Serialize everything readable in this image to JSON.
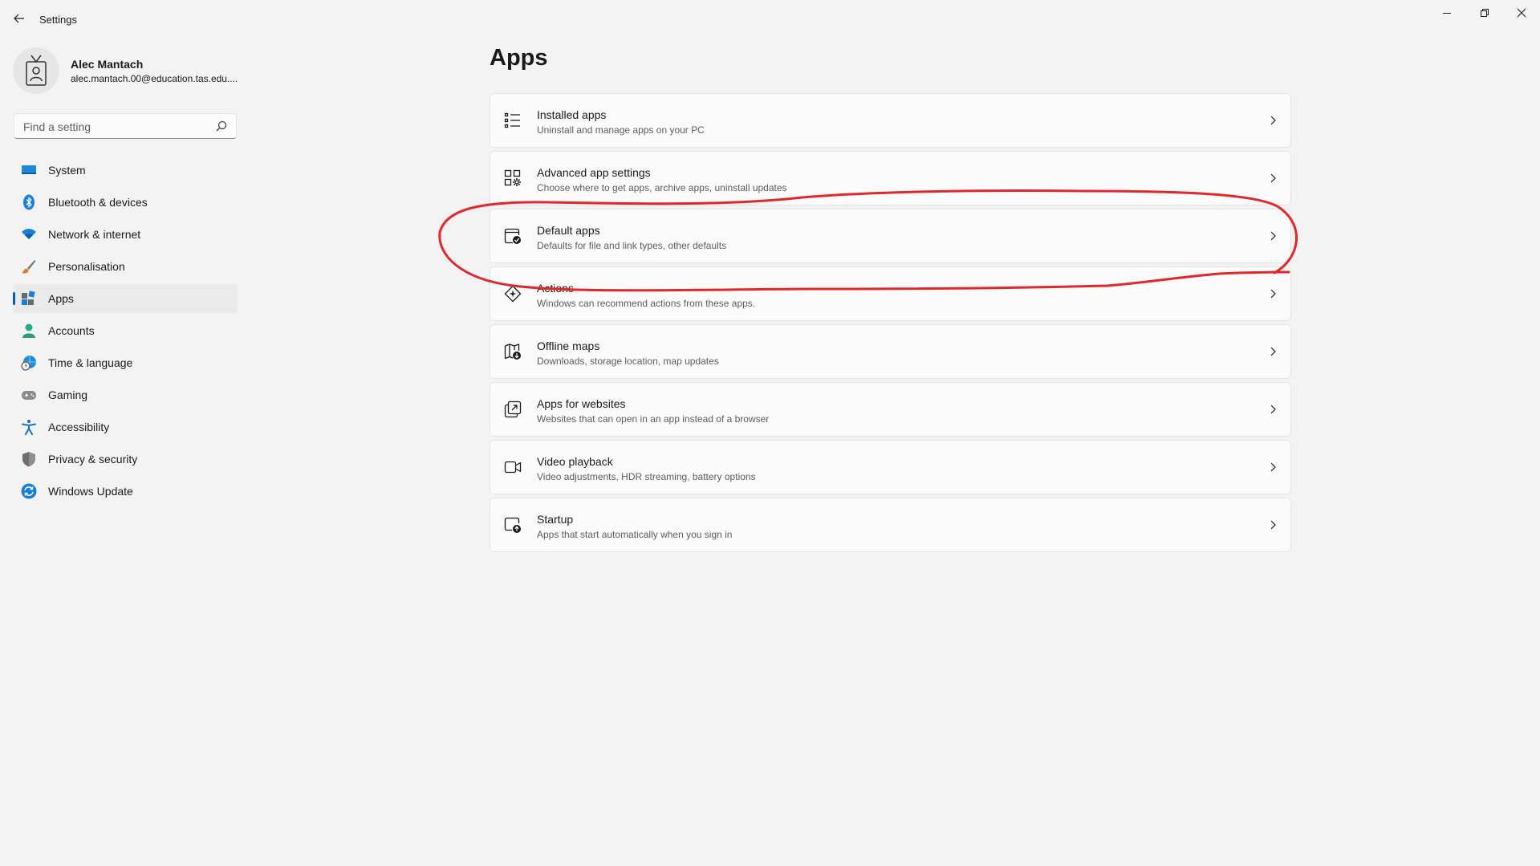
{
  "window": {
    "title": "Settings"
  },
  "profile": {
    "name": "Alec Mantach",
    "email": "alec.mantach.00@education.tas.edu...."
  },
  "search": {
    "placeholder": "Find a setting"
  },
  "nav": [
    {
      "label": "System",
      "icon": "system-icon"
    },
    {
      "label": "Bluetooth & devices",
      "icon": "bluetooth-icon"
    },
    {
      "label": "Network & internet",
      "icon": "wifi-icon"
    },
    {
      "label": "Personalisation",
      "icon": "brush-icon"
    },
    {
      "label": "Apps",
      "icon": "apps-icon",
      "selected": true
    },
    {
      "label": "Accounts",
      "icon": "person-icon"
    },
    {
      "label": "Time & language",
      "icon": "globe-clock-icon"
    },
    {
      "label": "Gaming",
      "icon": "gamepad-icon"
    },
    {
      "label": "Accessibility",
      "icon": "accessibility-icon"
    },
    {
      "label": "Privacy & security",
      "icon": "shield-icon"
    },
    {
      "label": "Windows Update",
      "icon": "update-icon"
    }
  ],
  "page": {
    "title": "Apps"
  },
  "items": [
    {
      "title": "Installed apps",
      "subtitle": "Uninstall and manage apps on your PC",
      "icon": "list-icon"
    },
    {
      "title": "Advanced app settings",
      "subtitle": "Choose where to get apps, archive apps, uninstall updates",
      "icon": "app-gear-icon"
    },
    {
      "title": "Default apps",
      "subtitle": "Defaults for file and link types, other defaults",
      "icon": "default-apps-icon"
    },
    {
      "title": "Actions",
      "subtitle": "Windows can recommend actions from these apps.",
      "icon": "actions-icon"
    },
    {
      "title": "Offline maps",
      "subtitle": "Downloads, storage location, map updates",
      "icon": "map-download-icon"
    },
    {
      "title": "Apps for websites",
      "subtitle": "Websites that can open in an app instead of a browser",
      "icon": "open-external-icon"
    },
    {
      "title": "Video playback",
      "subtitle": "Video adjustments, HDR streaming, battery options",
      "icon": "video-icon"
    },
    {
      "title": "Startup",
      "subtitle": "Apps that start automatically when you sign in",
      "icon": "startup-icon"
    }
  ],
  "colors": {
    "accent": "#005fb8",
    "annotation": "#e0282b",
    "background": "#f3f3f3"
  }
}
